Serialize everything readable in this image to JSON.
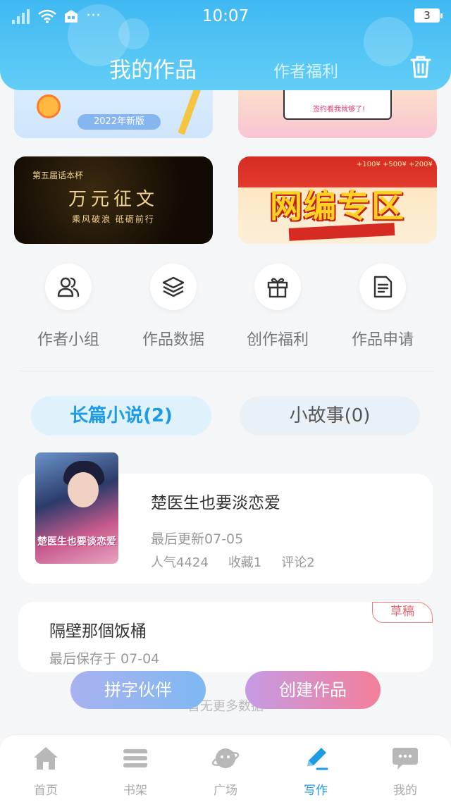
{
  "status_bar": {
    "time": "10:07",
    "battery": "3",
    "more": "···"
  },
  "header": {
    "active_tab": "我的作品",
    "other_tab": "作者福利"
  },
  "banners": {
    "a": {
      "chip": "2022年新版"
    },
    "b": {
      "caption": "签约看我就够了!"
    },
    "c": {
      "top": "第五届话本杯",
      "title": "万元征文",
      "sub": "乘风破浪 砥砺前行"
    },
    "d": {
      "title": "网编专区",
      "price": "+100¥ +500¥ +200¥"
    }
  },
  "actions": [
    {
      "label": "作者小组",
      "icon": "group-icon"
    },
    {
      "label": "作品数据",
      "icon": "layers-icon"
    },
    {
      "label": "创作福利",
      "icon": "gift-icon"
    },
    {
      "label": "作品申请",
      "icon": "document-icon"
    }
  ],
  "work_tabs": {
    "novel": "长篇小说(2)",
    "story": "小故事(0)"
  },
  "books": [
    {
      "title": "楚医生也要淡恋爱",
      "cover_text": "楚医生也要谈恋爱",
      "updated": "最后更新07-05",
      "popularity": "人气4424",
      "favorites": "收藏1",
      "comments": "评论2"
    }
  ],
  "draft": {
    "title": "隔壁那個饭桶",
    "saved": "最后保存于 07-04",
    "badge": "草稿"
  },
  "no_more": "暂无更多数据",
  "float_buttons": {
    "partner": "拼字伙伴",
    "create": "创建作品"
  },
  "bottom_nav": [
    {
      "label": "首页",
      "icon": "home-icon"
    },
    {
      "label": "书架",
      "icon": "bookshelf-icon"
    },
    {
      "label": "广场",
      "icon": "planet-icon"
    },
    {
      "label": "写作",
      "icon": "pen-icon",
      "active": true
    },
    {
      "label": "我的",
      "icon": "chat-icon"
    }
  ],
  "colors": {
    "accent": "#1d9be6",
    "header": "#4fc0f4",
    "draft_badge": "#e96670"
  }
}
